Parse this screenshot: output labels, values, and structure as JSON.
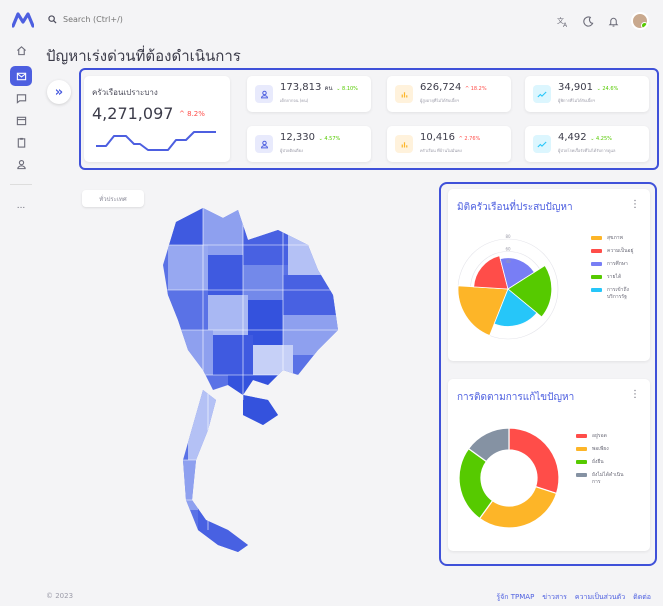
{
  "app": {
    "copyright": "© 2023"
  },
  "search": {
    "placeholder": "Search (Ctrl+/)"
  },
  "page": {
    "title": "ปัญหาเร่งด่วนที่ต้องดำเนินการ"
  },
  "colors": {
    "accent": "#4d5fe0",
    "frame": "#3f51d9",
    "up": "#56ca00",
    "down": "#ff4d49"
  },
  "main_stat": {
    "label": "ครัวเรือนเปราะบาง",
    "value": "4,271,097",
    "delta": "8.2%",
    "trend": "down"
  },
  "stats": [
    {
      "icon": "user-icon",
      "value": "173,813",
      "unit": "คน",
      "delta": "8.10%",
      "trend": "up",
      "sub": "เด็กยากจน (คน)"
    },
    {
      "icon": "bar-chart-icon",
      "value": "626,724",
      "unit": "",
      "delta": "18.2%",
      "trend": "down",
      "sub": "ผู้สูงอายุที่ไม่ได้รับเบี้ยฯ"
    },
    {
      "icon": "trend-up-icon",
      "value": "34,901",
      "unit": "",
      "delta": "24.6%",
      "trend": "up",
      "sub": "ผู้พิการที่ไม่ได้รับเบี้ยฯ"
    },
    {
      "icon": "user-icon",
      "value": "12,330",
      "unit": "",
      "delta": "4.57%",
      "trend": "up",
      "sub": "ผู้ป่วยติดเตียง"
    },
    {
      "icon": "bar-chart-icon",
      "value": "10,416",
      "unit": "",
      "delta": "2.76%",
      "trend": "down",
      "sub": "ครัวเรือน ที่บ้านไม่มั่นคง"
    },
    {
      "icon": "trend-up-icon",
      "value": "4,492",
      "unit": "",
      "delta": "4.25%",
      "trend": "up",
      "sub": "ผู้ป่วยโรคเรื้อรังที่ไม่ได้รับการดูแล"
    }
  ],
  "filter": {
    "label": "ทั่วประเทศ"
  },
  "sidebar": {
    "items": [
      {
        "name": "sidebar-item-home",
        "icon": "home-icon"
      },
      {
        "name": "sidebar-item-mail",
        "icon": "mail-icon"
      },
      {
        "name": "sidebar-item-chat",
        "icon": "chat-icon"
      },
      {
        "name": "sidebar-item-calendar",
        "icon": "calendar-icon"
      },
      {
        "name": "sidebar-item-clipboard",
        "icon": "clipboard-icon"
      },
      {
        "name": "sidebar-item-user",
        "icon": "user-icon"
      },
      {
        "name": "sidebar-item-more",
        "icon": "more-icon",
        "label": "..."
      }
    ]
  },
  "chart_data": [
    {
      "type": "polar-area",
      "title": "มิติครัวเรือนที่ประสบปัญหา",
      "tick_labels": [
        "80",
        "60",
        "40"
      ],
      "categories": [
        "สุขภาพ",
        "ความเป็นอยู่",
        "การศึกษา",
        "รายได้",
        "การเข้าถึงบริการรัฐ"
      ],
      "values": [
        80,
        55,
        50,
        70,
        60
      ],
      "colors": [
        "#fdb528",
        "#ff4d49",
        "#787ef5",
        "#56ca00",
        "#26c6f9"
      ]
    },
    {
      "type": "donut",
      "title": "การติดตามการแก้ไขปัญหา",
      "categories": [
        "อยู่รอด",
        "พอเพียง",
        "ยั่งยืน",
        "ยังไม่ได้ดำเนินการ"
      ],
      "values": [
        30,
        30,
        25,
        15
      ],
      "colors": [
        "#ff4d49",
        "#fdb528",
        "#56ca00",
        "#8592a3"
      ]
    }
  ],
  "footer": {
    "links": [
      "รู้จัก TPMAP",
      "ข่าวสาร",
      "ความเป็นส่วนตัว",
      "ติดต่อ"
    ]
  }
}
